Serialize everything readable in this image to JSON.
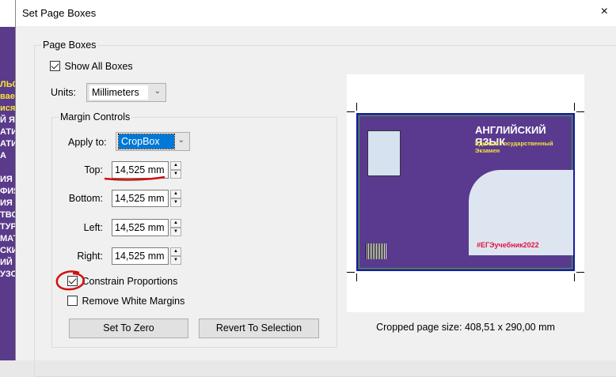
{
  "background_fragments": [
    "ЛЬС",
    "вает",
    "ися",
    "Й Я",
    "АТИ",
    "АТИ",
    "А",
    "",
    "ИЯ",
    "ФИЯ",
    "ИЯ",
    "ТВО",
    "ТУР",
    "МАТ",
    "СКИ",
    "ИЙ",
    "УЗС"
  ],
  "dialog": {
    "title": "Set Page Boxes",
    "close_icon": "×"
  },
  "page_boxes": {
    "legend": "Page Boxes",
    "show_all_boxes_label": "Show All Boxes",
    "show_all_boxes_checked": true,
    "units_label": "Units:",
    "units_value": "Millimeters"
  },
  "margin_controls": {
    "legend": "Margin Controls",
    "apply_to_label": "Apply to:",
    "apply_to_value": "CropBox",
    "top_label": "Top:",
    "top_value": "14,525 mm",
    "bottom_label": "Bottom:",
    "bottom_value": "14,525 mm",
    "left_label": "Left:",
    "left_value": "14,525 mm",
    "right_label": "Right:",
    "right_value": "14,525 mm",
    "constrain_label": "Constrain Proportions",
    "constrain_checked": true,
    "remove_white_label": "Remove White Margins",
    "remove_white_checked": false,
    "set_zero_label": "Set To Zero",
    "revert_label": "Revert To Selection"
  },
  "preview": {
    "cover_title": "АНГЛИЙСКИЙ ЯЗЫК",
    "cover_subtitle": "Единый Государственный Экзамен",
    "cover_hashtag": "#ЕГЭучебник2022",
    "cropped_size": "Cropped page size: 408,51 x 290,00 mm"
  },
  "colors": {
    "annotation": "#d01010",
    "accent": "#0078d7",
    "cover": "#5a3a8f"
  }
}
